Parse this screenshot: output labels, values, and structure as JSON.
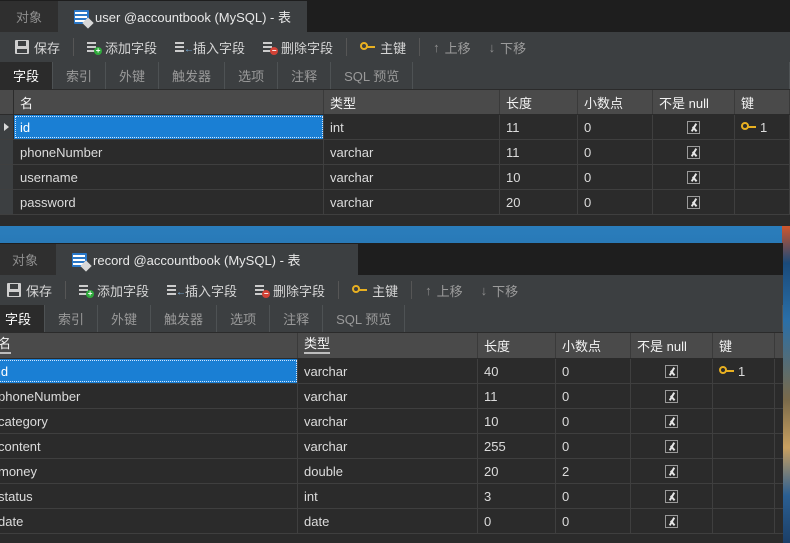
{
  "app": {
    "theme_bg": "#2b2b2b",
    "accent_selection": "#1a7fd4",
    "key_color": "#e8b021"
  },
  "windows": [
    {
      "id": "window-user",
      "titlebar": {
        "object_tab": "对象",
        "doc_tab": "user @accountbook (MySQL) - 表",
        "doc_icon": "table-icon"
      },
      "toolbar": {
        "save": "保存",
        "add_field": "添加字段",
        "insert_field": "插入字段",
        "delete_field": "删除字段",
        "primary_key": "主键",
        "move_up": "上移",
        "move_down": "下移"
      },
      "subtabs": [
        {
          "label": "字段",
          "active": true
        },
        {
          "label": "索引",
          "active": false
        },
        {
          "label": "外键",
          "active": false
        },
        {
          "label": "触发器",
          "active": false
        },
        {
          "label": "选项",
          "active": false
        },
        {
          "label": "注释",
          "active": false
        },
        {
          "label": "SQL 预览",
          "active": false
        }
      ],
      "grid": {
        "columns": [
          "名",
          "类型",
          "长度",
          "小数点",
          "不是 null",
          "键"
        ],
        "rows": [
          {
            "name": "id",
            "type": "int",
            "length": "11",
            "decimals": "0",
            "not_null": true,
            "key": "1",
            "selected": true
          },
          {
            "name": "phoneNumber",
            "type": "varchar",
            "length": "11",
            "decimals": "0",
            "not_null": true,
            "key": "",
            "selected": false
          },
          {
            "name": "username",
            "type": "varchar",
            "length": "10",
            "decimals": "0",
            "not_null": true,
            "key": "",
            "selected": false
          },
          {
            "name": "password",
            "type": "varchar",
            "length": "20",
            "decimals": "0",
            "not_null": true,
            "key": "",
            "selected": false
          }
        ]
      }
    },
    {
      "id": "window-record",
      "titlebar": {
        "object_tab": "对象",
        "doc_tab": "record @accountbook (MySQL) - 表",
        "doc_icon": "table-icon"
      },
      "toolbar": {
        "save": "保存",
        "add_field": "添加字段",
        "insert_field": "插入字段",
        "delete_field": "删除字段",
        "primary_key": "主键",
        "move_up": "上移",
        "move_down": "下移"
      },
      "subtabs": [
        {
          "label": "字段",
          "active": true
        },
        {
          "label": "索引",
          "active": false
        },
        {
          "label": "外键",
          "active": false
        },
        {
          "label": "触发器",
          "active": false
        },
        {
          "label": "选项",
          "active": false
        },
        {
          "label": "注释",
          "active": false
        },
        {
          "label": "SQL 预览",
          "active": false
        }
      ],
      "grid": {
        "columns": [
          "名",
          "类型",
          "长度",
          "小数点",
          "不是 null",
          "键"
        ],
        "rows": [
          {
            "name": "id",
            "type": "varchar",
            "length": "40",
            "decimals": "0",
            "not_null": true,
            "key": "1",
            "selected": true
          },
          {
            "name": "phoneNumber",
            "type": "varchar",
            "length": "11",
            "decimals": "0",
            "not_null": true,
            "key": "",
            "selected": false
          },
          {
            "name": "category",
            "type": "varchar",
            "length": "10",
            "decimals": "0",
            "not_null": true,
            "key": "",
            "selected": false
          },
          {
            "name": "content",
            "type": "varchar",
            "length": "255",
            "decimals": "0",
            "not_null": true,
            "key": "",
            "selected": false
          },
          {
            "name": "money",
            "type": "double",
            "length": "20",
            "decimals": "2",
            "not_null": true,
            "key": "",
            "selected": false
          },
          {
            "name": "status",
            "type": "int",
            "length": "3",
            "decimals": "0",
            "not_null": true,
            "key": "",
            "selected": false
          },
          {
            "name": "date",
            "type": "date",
            "length": "0",
            "decimals": "0",
            "not_null": true,
            "key": "",
            "selected": false
          }
        ]
      }
    }
  ]
}
